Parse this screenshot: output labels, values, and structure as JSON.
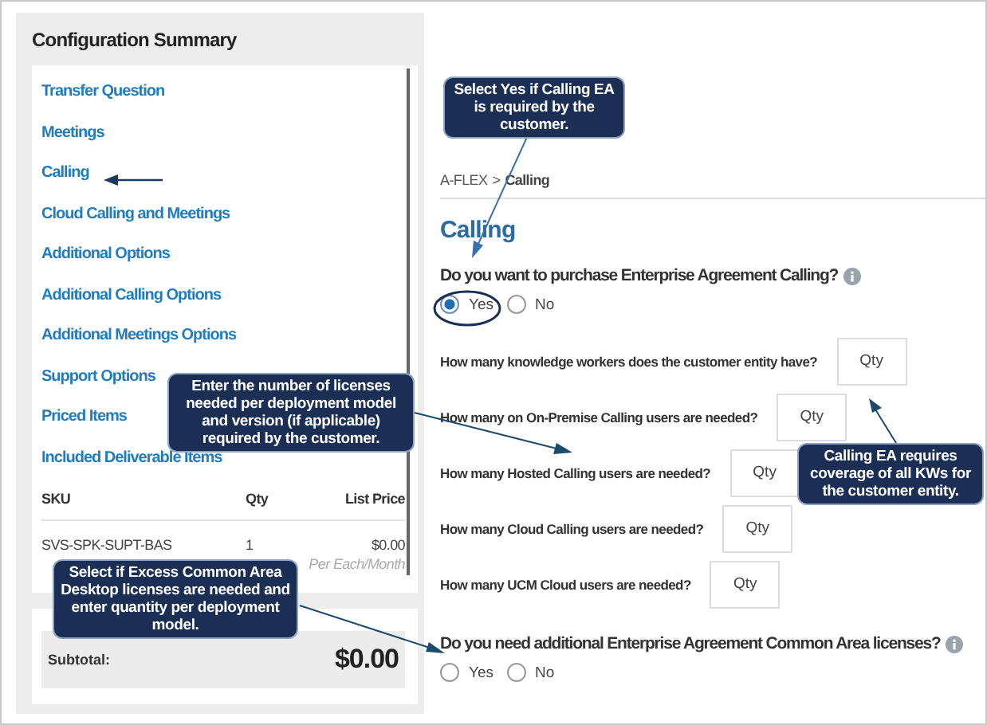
{
  "sidebar": {
    "title": "Configuration Summary",
    "items": [
      {
        "label": "Transfer Question"
      },
      {
        "label": "Meetings"
      },
      {
        "label": "Calling"
      },
      {
        "label": "Cloud Calling and Meetings"
      },
      {
        "label": "Additional Options"
      },
      {
        "label": "Additional Calling Options"
      },
      {
        "label": "Additional Meetings Options"
      },
      {
        "label": "Support Options"
      },
      {
        "label": "Priced Items"
      },
      {
        "label": "Included Deliverable Items"
      }
    ],
    "table": {
      "columns": [
        "SKU",
        "Qty",
        "List Price"
      ],
      "rows": [
        {
          "sku": "SVS-SPK-SUPT-BAS",
          "qty": "1",
          "price": "$0.00",
          "note": "Per Each/Month"
        }
      ]
    },
    "subtotal": {
      "label": "Subtotal:",
      "value": "$0.00"
    }
  },
  "breadcrumb": {
    "parent": "A-FLEX",
    "separator": ">",
    "current": "Calling"
  },
  "heading": "Calling",
  "questions": [
    {
      "kind": "radio",
      "text": "Do you want to purchase Enterprise Agreement Calling?",
      "info": true,
      "options": [
        {
          "label": "Yes",
          "selected": true
        },
        {
          "label": "No",
          "selected": false
        }
      ]
    },
    {
      "kind": "qty",
      "text": "How many knowledge workers does the customer entity have?",
      "placeholder": "Qty"
    },
    {
      "kind": "qty",
      "text": "How many on On-Premise Calling users are needed?",
      "placeholder": "Qty"
    },
    {
      "kind": "qty",
      "text": "How many Hosted Calling users are needed?",
      "placeholder": "Qty"
    },
    {
      "kind": "qty",
      "text": "How many Cloud Calling users are needed?",
      "placeholder": "Qty"
    },
    {
      "kind": "qty",
      "text": "How many UCM Cloud users are needed?",
      "placeholder": "Qty"
    },
    {
      "kind": "radio",
      "text": "Do you need additional Enterprise Agreement Common Area licenses?",
      "info": true,
      "options": [
        {
          "label": "Yes",
          "selected": false
        },
        {
          "label": "No",
          "selected": false
        }
      ]
    }
  ],
  "callouts": [
    {
      "text": "Select Yes if Calling EA is required by the customer."
    },
    {
      "text": "Enter the number of licenses needed per deployment model and version (if applicable) required by the customer."
    },
    {
      "text": "Select if Excess Common Area Desktop licenses are needed and enter quantity per deployment model."
    },
    {
      "text": "Calling EA requires coverage of all KWs for the customer entity."
    }
  ]
}
